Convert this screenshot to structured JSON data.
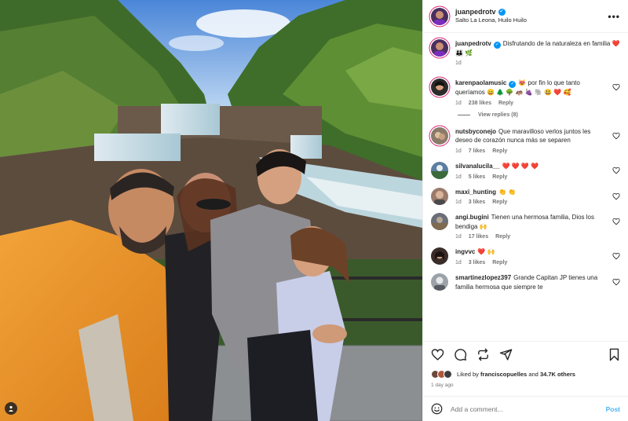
{
  "header": {
    "username": "juanpedrotv",
    "location": "Salto La Leona, Huilo Huilo",
    "more_icon": "more-horizontal-icon"
  },
  "caption": {
    "username": "juanpedrotv",
    "text": "Disfrutando de la naturaleza en familia ❤️ 👪 🌿",
    "time": "1d"
  },
  "comments": [
    {
      "username": "karenpaolamusic",
      "verified": true,
      "text": "😻 por fin lo que tanto queríamos 😄 🌲 🌳 🦛 🍇 🐘 😃 ❤️ 🥰",
      "time": "1d",
      "likes": "238 likes",
      "reply": "Reply",
      "view_replies": "View replies (8)",
      "avatar_color": "#2b2b2b"
    },
    {
      "username": "nutsbyconejo",
      "verified": false,
      "text": "Que maravilloso verlos juntos les deseo de corazón nunca más se separen",
      "time": "1d",
      "likes": "7 likes",
      "reply": "Reply",
      "avatar_color": "#8a7a6a"
    },
    {
      "username": "silvanalucila__",
      "verified": false,
      "text": "❤️ ❤️ ❤️ ❤️",
      "time": "1d",
      "likes": "5 likes",
      "reply": "Reply",
      "avatar_color": "#5a7ea0"
    },
    {
      "username": "maxi_hunting",
      "verified": false,
      "text": "👏 👏",
      "time": "1d",
      "likes": "3 likes",
      "reply": "Reply",
      "avatar_color": "#9a7b6b"
    },
    {
      "username": "angi.bugini",
      "verified": false,
      "text": "Tienen una hermosa familia, Dios los bendiga 🙌",
      "time": "1d",
      "likes": "17 likes",
      "reply": "Reply",
      "avatar_color": "#6b6f78"
    },
    {
      "username": "ingvvc",
      "verified": false,
      "text": "❤️ 🙌",
      "time": "1d",
      "likes": "3 likes",
      "reply": "Reply",
      "avatar_color": "#3a2c28"
    },
    {
      "username": "smartinezlopez397",
      "verified": false,
      "text": "Grande Capitan JP tienes una familia hermosa que siempre te",
      "time": "1d",
      "likes": "",
      "reply": "",
      "avatar_color": "#9ca3a8"
    }
  ],
  "likes": {
    "prefix": "Liked by",
    "user": "franciscopuelles",
    "and": "and",
    "others": "34.7K others"
  },
  "date": "1 day ago",
  "add_comment": {
    "placeholder": "Add a comment...",
    "post_label": "Post"
  },
  "colors": {
    "accent": "#0095f6",
    "post_button": "#4cb5f9",
    "heart": "#ed4956"
  }
}
